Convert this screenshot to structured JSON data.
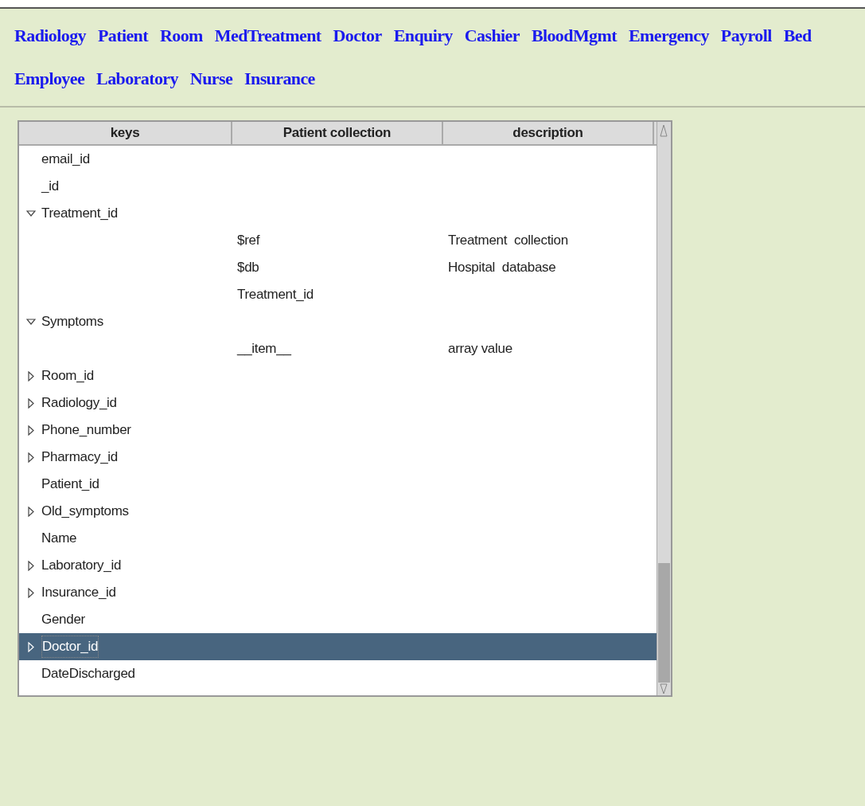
{
  "nav_links": [
    "Radiology",
    "Patient",
    "Room",
    "MedTreatment",
    "Doctor",
    "Enquiry",
    "Cashier",
    "BloodMgmt",
    "Emergency",
    "Payroll",
    "Bed",
    "Employee",
    "Laboratory",
    "Nurse",
    "Insurance"
  ],
  "table": {
    "columns": [
      "keys",
      "Patient collection",
      "description"
    ],
    "rows": [
      {
        "key": "email_id",
        "kind": "leaf",
        "selected": false
      },
      {
        "key": "_id",
        "kind": "leaf",
        "selected": false
      },
      {
        "key": "Treatment_id",
        "kind": "branch",
        "expanded": true,
        "selected": false,
        "children": [
          {
            "value": "$ref",
            "description": "Treatment  collection"
          },
          {
            "value": "$db",
            "description": "Hospital  database"
          },
          {
            "value": "Treatment_id"
          }
        ]
      },
      {
        "key": "Symptoms",
        "kind": "branch",
        "expanded": true,
        "selected": false,
        "children": [
          {
            "value": "__item__",
            "description": "array value"
          }
        ]
      },
      {
        "key": "Room_id",
        "kind": "branch",
        "expanded": false,
        "selected": false
      },
      {
        "key": "Radiology_id",
        "kind": "branch",
        "expanded": false,
        "selected": false
      },
      {
        "key": "Phone_number",
        "kind": "branch",
        "expanded": false,
        "selected": false
      },
      {
        "key": "Pharmacy_id",
        "kind": "branch",
        "expanded": false,
        "selected": false
      },
      {
        "key": "Patient_id",
        "kind": "leaf",
        "selected": false
      },
      {
        "key": "Old_symptoms",
        "kind": "branch",
        "expanded": false,
        "selected": false
      },
      {
        "key": "Name",
        "kind": "leaf",
        "selected": false
      },
      {
        "key": "Laboratory_id",
        "kind": "branch",
        "expanded": false,
        "selected": false
      },
      {
        "key": "Insurance_id",
        "kind": "branch",
        "expanded": false,
        "selected": false
      },
      {
        "key": "Gender",
        "kind": "leaf",
        "selected": false
      },
      {
        "key": "Doctor_id",
        "kind": "branch",
        "expanded": false,
        "selected": true
      },
      {
        "key": "DateDischarged",
        "kind": "leaf",
        "selected": false
      }
    ]
  }
}
